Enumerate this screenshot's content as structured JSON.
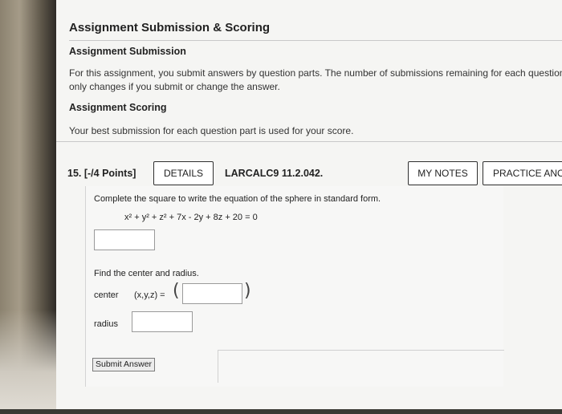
{
  "header": {
    "title": "Assignment Submission & Scoring"
  },
  "submission": {
    "heading": "Assignment Submission",
    "line1": "For this assignment, you submit answers by question parts. The number of submissions remaining for each question p",
    "line2": "only changes if you submit or change the answer."
  },
  "scoring": {
    "heading": "Assignment Scoring",
    "text": "Your best submission for each question part is used for your score."
  },
  "question": {
    "number_label": "15.  [-/4 Points]",
    "details_label": "DETAILS",
    "code": "LARCALC9 11.2.042.",
    "my_notes_label": "MY NOTES",
    "practice_label": "PRACTICE ANO",
    "prompt": "Complete the square to write the equation of the sphere in standard form.",
    "equation": "x² + y² + z² + 7x - 2y + 8z + 20 = 0",
    "find_text": "Find the center and radius.",
    "center_label": "center",
    "center_vars": "(x,y,z) =",
    "radius_label": "radius",
    "submit_label": "Submit Answer"
  },
  "colors": {
    "screen_bg": "#f5f5f3",
    "button_border": "#2f2f2f"
  }
}
